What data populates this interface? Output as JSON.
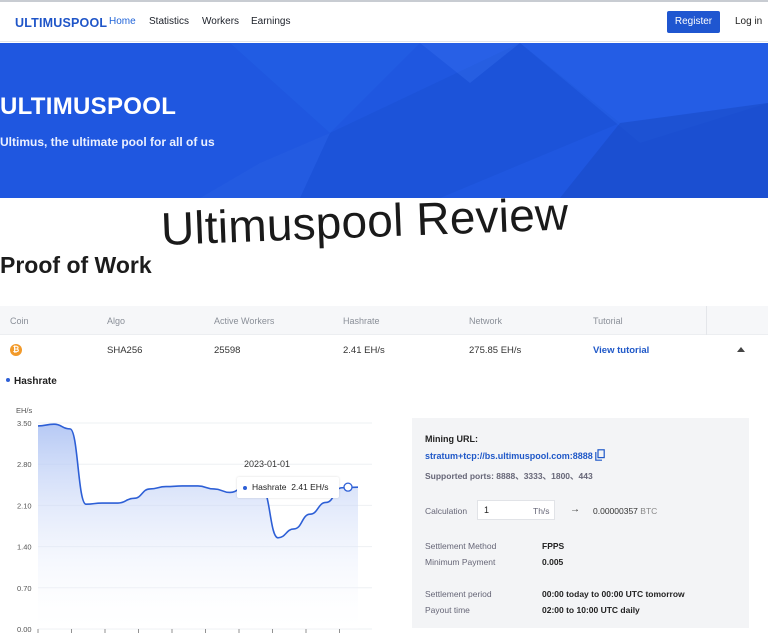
{
  "nav": {
    "brand": "ULTIMUSPOOL",
    "links": [
      {
        "label": "Home",
        "active": true
      },
      {
        "label": "Statistics",
        "active": false
      },
      {
        "label": "Workers",
        "active": false
      },
      {
        "label": "Earnings",
        "active": false
      }
    ],
    "register_label": "Register",
    "login_label": "Log in"
  },
  "hero": {
    "title": "ULTIMUSPOOL",
    "subtitle": "Ultimus, the ultimate pool for all of us"
  },
  "overlay_title": "Ultimuspool Review",
  "section_title": "Proof of Work",
  "table": {
    "headers": [
      "Coin",
      "Algo",
      "Active Workers",
      "Hashrate",
      "Network",
      "Tutorial"
    ],
    "row": {
      "coin_icon_glyph": "₿",
      "algo": "SHA256",
      "active_workers": "25598",
      "hashrate": "2.41 EH/s",
      "network": "275.85 EH/s",
      "tutorial": "View tutorial"
    }
  },
  "chart_legend": "Hashrate",
  "tooltip": {
    "date": "2023-01-01",
    "series": "Hashrate",
    "value": "2.41 EH/s"
  },
  "chart_data": {
    "type": "area",
    "title": "",
    "ylabel": "EH/s",
    "ylim": [
      0,
      3.5
    ],
    "yticks": [
      "3.50",
      "2.80",
      "2.10",
      "1.40",
      "0.70",
      "0.00"
    ],
    "x": [
      0,
      1,
      2,
      3,
      4,
      5,
      6,
      7,
      8,
      9,
      10,
      11,
      12,
      13,
      14,
      15,
      16,
      17,
      18,
      19,
      20
    ],
    "series": [
      {
        "name": "Hashrate",
        "values": [
          3.45,
          3.48,
          3.4,
          2.12,
          2.14,
          2.14,
          2.22,
          2.38,
          2.42,
          2.43,
          2.43,
          2.38,
          2.32,
          2.42,
          2.38,
          1.55,
          1.7,
          1.95,
          2.15,
          2.4,
          2.41
        ]
      }
    ],
    "color": "#2d5fd6",
    "fill": "#b7caf5"
  },
  "panel": {
    "mining_url_label": "Mining URL:",
    "mining_url": "stratum+tcp://bs.ultimuspool.com:8888",
    "ports": "Supported ports: 8888、3333、1800、443",
    "calc_label": "Calculation",
    "calc_value": "1",
    "calc_unit": "Th/s",
    "calc_arrow": "→",
    "calc_result": "0.00000357",
    "calc_currency": "BTC",
    "settlement_method_label": "Settlement Method",
    "settlement_method": "FPPS",
    "min_payment_label": "Minimum Payment",
    "min_payment": "0.005",
    "settlement_period_label": "Settlement period",
    "settlement_period": "00:00 today to 00:00 UTC tomorrow",
    "payout_time_label": "Payout time",
    "payout_time": "02:00 to 10:00 UTC daily"
  }
}
